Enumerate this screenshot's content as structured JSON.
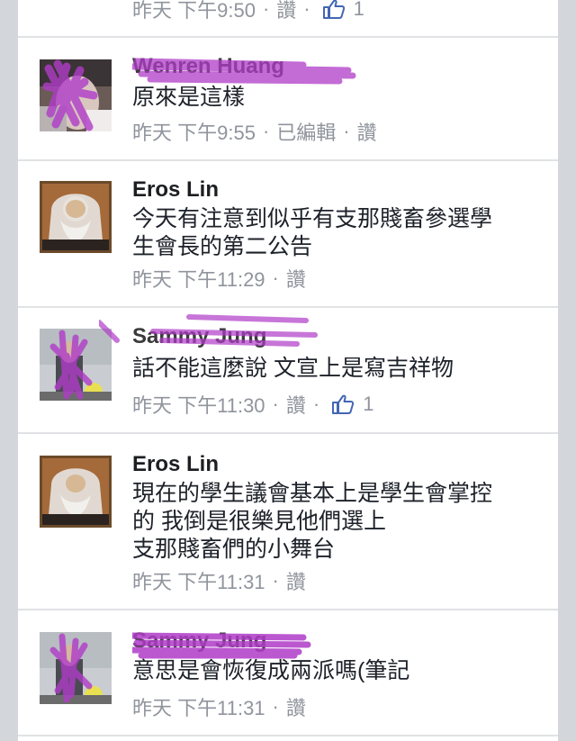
{
  "top_row": {
    "time": "昨天 下午9:50",
    "action_like": "讚",
    "like_count": "1"
  },
  "comments": [
    {
      "name": "Wenren Huang",
      "lines": [
        "原來是這樣"
      ],
      "time": "昨天 下午9:55",
      "edited": "已編輯",
      "action_like": "讚"
    },
    {
      "name": "Eros Lin",
      "lines": [
        "今天有注意到似乎有支那賤畜參選學",
        "生會長的第二公告"
      ],
      "time": "昨天 下午11:29",
      "action_like": "讚"
    },
    {
      "name": "Sammy Jung",
      "lines": [
        "話不能這麼說 文宣上是寫吉祥物"
      ],
      "time": "昨天 下午11:30",
      "action_like": "讚",
      "like_count": "1"
    },
    {
      "name": "Eros Lin",
      "lines": [
        "現在的學生議會基本上是學生會掌控",
        "的 我倒是很樂見他們選上",
        "支那賤畜們的小舞台"
      ],
      "time": "昨天 下午11:31",
      "action_like": "讚"
    },
    {
      "name": "Sammy Jung",
      "lines": [
        "意思是會恢復成兩派嗎(筆記"
      ],
      "time": "昨天 下午11:31",
      "action_like": "讚"
    }
  ],
  "colors": {
    "meta": "#90949c",
    "text": "#1d2129",
    "like_blue": "#4267b2",
    "scribble": "#b03cc8",
    "side": "#d3d6db"
  },
  "icons": {
    "like": "thumbs-up-icon",
    "separator": "·"
  }
}
